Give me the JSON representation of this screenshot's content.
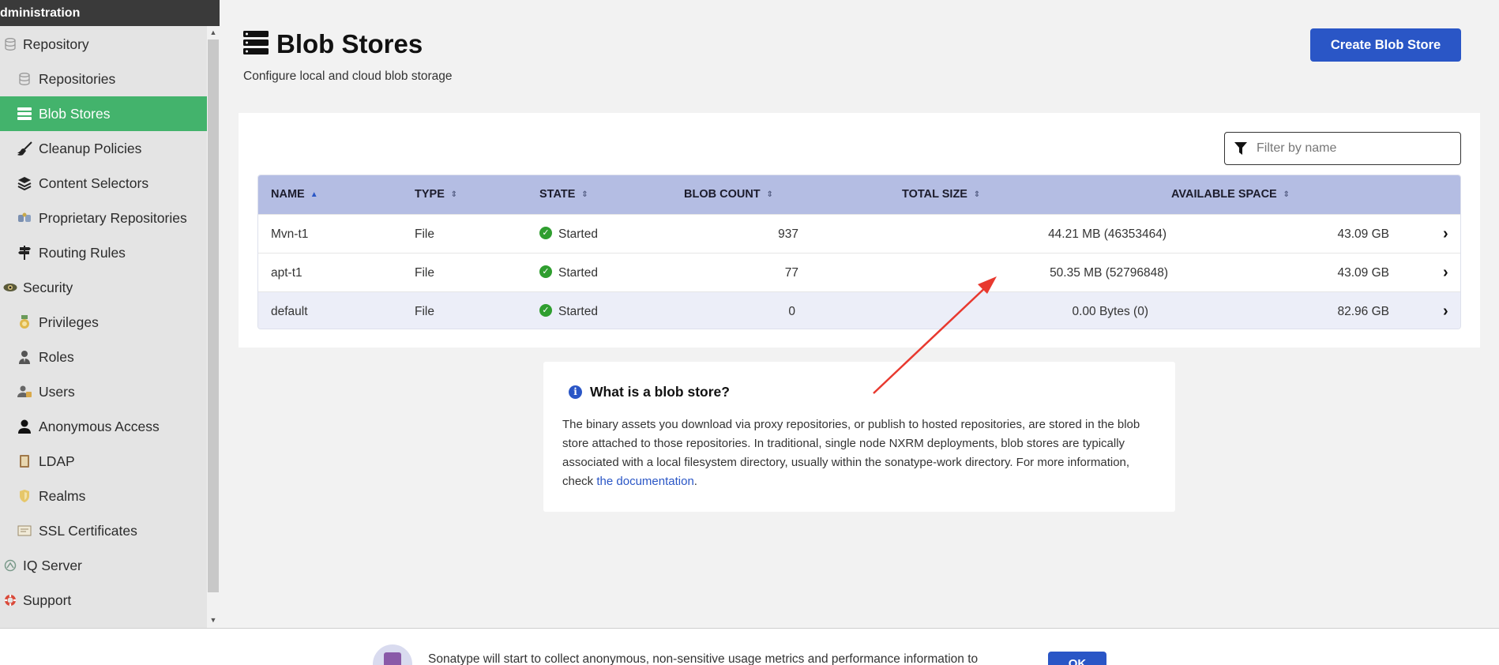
{
  "sidebar": {
    "header": "dministration",
    "items": [
      {
        "label": "Repository",
        "level": "top",
        "icon": "database-icon"
      },
      {
        "label": "Repositories",
        "level": "sub",
        "icon": "database-icon"
      },
      {
        "label": "Blob Stores",
        "level": "sub",
        "icon": "server-icon",
        "active": true
      },
      {
        "label": "Cleanup Policies",
        "level": "sub",
        "icon": "broom-icon"
      },
      {
        "label": "Content Selectors",
        "level": "sub",
        "icon": "layers-icon"
      },
      {
        "label": "Proprietary Repositories",
        "level": "sub",
        "icon": "proprietary-icon"
      },
      {
        "label": "Routing Rules",
        "level": "sub",
        "icon": "signpost-icon"
      },
      {
        "label": "Security",
        "level": "top",
        "icon": "eye-icon"
      },
      {
        "label": "Privileges",
        "level": "sub",
        "icon": "medal-icon"
      },
      {
        "label": "Roles",
        "level": "sub",
        "icon": "user-tie-icon"
      },
      {
        "label": "Users",
        "level": "sub",
        "icon": "users-icon"
      },
      {
        "label": "Anonymous Access",
        "level": "sub",
        "icon": "user-icon"
      },
      {
        "label": "LDAP",
        "level": "sub",
        "icon": "book-icon"
      },
      {
        "label": "Realms",
        "level": "sub",
        "icon": "shield-icon"
      },
      {
        "label": "SSL Certificates",
        "level": "sub",
        "icon": "certificate-icon"
      },
      {
        "label": "IQ Server",
        "level": "top",
        "icon": "iq-icon"
      },
      {
        "label": "Support",
        "level": "top",
        "icon": "lifebuoy-icon"
      }
    ]
  },
  "page": {
    "title": "Blob Stores",
    "subtitle": "Configure local and cloud blob storage",
    "create_button": "Create Blob Store",
    "filter_placeholder": "Filter by name"
  },
  "table": {
    "columns": [
      "NAME",
      "TYPE",
      "STATE",
      "BLOB COUNT",
      "TOTAL SIZE",
      "AVAILABLE SPACE"
    ],
    "rows": [
      {
        "name": "Mvn-t1",
        "type": "File",
        "state": "Started",
        "blob_count": "937",
        "total_size": "44.21 MB (46353464)",
        "available_space": "43.09 GB"
      },
      {
        "name": "apt-t1",
        "type": "File",
        "state": "Started",
        "blob_count": "77",
        "total_size": "50.35 MB (52796848)",
        "available_space": "43.09 GB"
      },
      {
        "name": "default",
        "type": "File",
        "state": "Started",
        "blob_count": "0",
        "total_size": "0.00 Bytes (0)",
        "available_space": "82.96 GB"
      }
    ]
  },
  "info": {
    "title": "What is a blob store?",
    "text_before_link": "The binary assets you download via proxy repositories, or publish to hosted repositories, are stored in the blob store attached to those repositories. In traditional, single node NXRM deployments, blob stores are typically associated with a local filesystem directory, usually within the sonatype-work directory. For more information, check ",
    "link_text": "the documentation",
    "text_after_link": "."
  },
  "banner": {
    "text": "Sonatype will start to collect anonymous, non-sensitive usage metrics and performance information to",
    "ok_label": "OK"
  },
  "colors": {
    "active_nav": "#43b36c",
    "primary": "#2a56c6",
    "table_header": "#b4bde3",
    "annotation_arrow": "#e8392f"
  }
}
